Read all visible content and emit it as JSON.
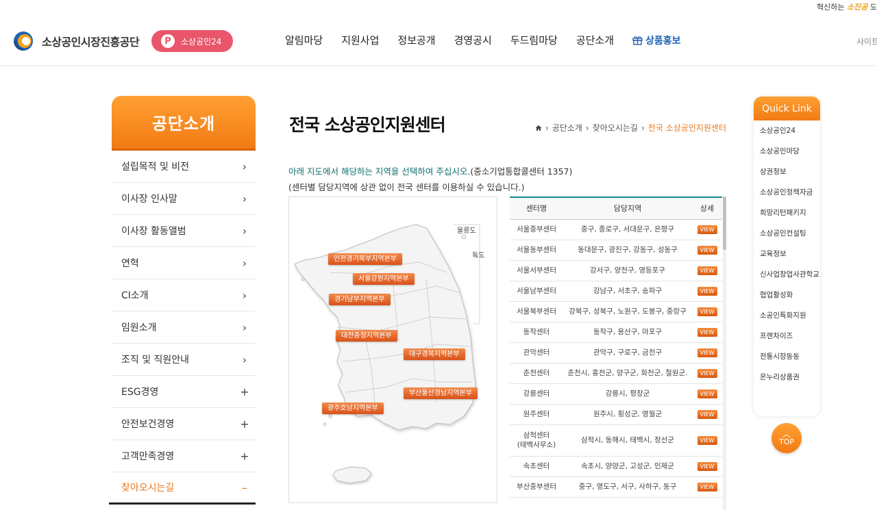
{
  "header": {
    "slogan_prefix": "혁신하는 ",
    "slogan_highlight": "소진공",
    "slogan_suffix": " 도",
    "org_name": "소상공인시장진흥공단",
    "pill_icon": "P",
    "pill_label": "소상공인24",
    "nav": [
      "알림마당",
      "지원사업",
      "정보공개",
      "경영공시",
      "두드림마당",
      "공단소개"
    ],
    "promo_label": "상품홍보",
    "sitemap_label": "사이트"
  },
  "lnb": {
    "title": "공단소개",
    "items": [
      {
        "label": "설립목적 및 비전",
        "sym": "›"
      },
      {
        "label": "이사장 인사말",
        "sym": "›"
      },
      {
        "label": "이사장 활동앨범",
        "sym": "›"
      },
      {
        "label": "연혁",
        "sym": "›"
      },
      {
        "label": "CI소개",
        "sym": "›"
      },
      {
        "label": "임원소개",
        "sym": "›"
      },
      {
        "label": "조직 및 직원안내",
        "sym": "›"
      },
      {
        "label": "ESG경영",
        "sym": "+"
      },
      {
        "label": "안전보건경영",
        "sym": "+"
      },
      {
        "label": "고객만족경영",
        "sym": "+"
      },
      {
        "label": "찾아오시는길",
        "sym": "–"
      }
    ]
  },
  "content": {
    "title": "전국 소상공인지원센터",
    "breadcrumb": [
      "공단소개",
      "찾아오시는길",
      "전국 소상공인지원센터"
    ],
    "intro_highlight": "아래 지도에서 해당하는 지역을 선택하여 주십시오.",
    "intro_rest": "(중소기업통합콜센터 1357)",
    "intro_note": "(센터별 담당지역에 상관 없이 전국 센터를 이용하실 수 있습니다.)"
  },
  "map": {
    "islands": [
      "울릉도",
      "독도"
    ],
    "regions": [
      "인천경기북부지역본부",
      "서울강원지역본부",
      "경기남부지역본부",
      "대전충청지역본부",
      "대구경북지역본부",
      "부산울산경남지역본부",
      "광주호남지역본부"
    ]
  },
  "table": {
    "headers": [
      "센터명",
      "담당지역",
      "상세"
    ],
    "view_label": "VIEW",
    "rows": [
      {
        "name": "서울중부센터",
        "area": "중구, 종로구, 서대문구, 은평구"
      },
      {
        "name": "서울동부센터",
        "area": "동대문구, 광진구, 강동구, 성동구"
      },
      {
        "name": "서울서부센터",
        "area": "강서구, 양천구, 영등포구"
      },
      {
        "name": "서울남부센터",
        "area": "강남구, 서초구, 송파구"
      },
      {
        "name": "서울북부센터",
        "area": "강북구, 성북구, 노원구, 도봉구, 중랑구"
      },
      {
        "name": "동작센터",
        "area": "동작구, 용산구, 마포구"
      },
      {
        "name": "관악센터",
        "area": "관악구, 구로구, 금천구"
      },
      {
        "name": "춘천센터",
        "area": "춘천시, 홍천군, 양구군, 화천군, 철원군."
      },
      {
        "name": "강릉센터",
        "area": "강릉시, 평창군"
      },
      {
        "name": "원주센터",
        "area": "원주시, 횡성군, 영월군"
      },
      {
        "name": "삼척센터",
        "name2": "(태백사무소)",
        "area": "삼척시, 동해시, 태백시, 정선군"
      },
      {
        "name": "속초센터",
        "area": "속초시, 양양군, 고성군, 인제군"
      },
      {
        "name": "부산중부센터",
        "area": "중구, 영도구, 서구, 사하구, 동구"
      }
    ]
  },
  "quick": {
    "title": "Quick Link",
    "items": [
      "소상공인24",
      "소상공인마당",
      "상권정보",
      "소상공인정책자금",
      "희망리턴패키지",
      "소상공인컨설팅",
      "교육정보",
      "신사업창업사관학교",
      "협업활성화",
      "소공인특화지원",
      "프랜차이즈",
      "전통시장동동",
      "온누리상품권"
    ],
    "top_label": "TOP"
  },
  "colors": {
    "brand_orange": "#f27a14",
    "pill_pink": "#e9566b",
    "promo_blue": "#1f63b3",
    "table_accent": "#1a8a8a"
  }
}
